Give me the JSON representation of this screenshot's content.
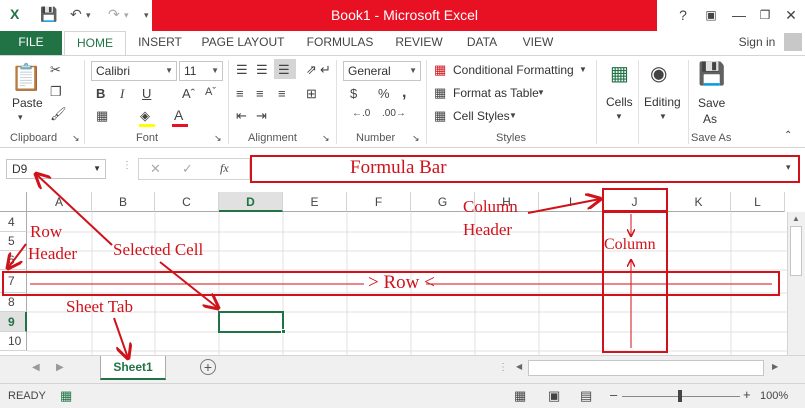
{
  "window": {
    "title": "Book1 - Microsoft Excel",
    "help_label": "?",
    "signin_label": "Sign in"
  },
  "tabs": [
    "FILE",
    "HOME",
    "INSERT",
    "PAGE LAYOUT",
    "FORMULAS",
    "REVIEW",
    "DATA",
    "VIEW"
  ],
  "ribbon": {
    "clipboard": {
      "paste_label": "Paste",
      "group_label": "Clipboard"
    },
    "font": {
      "font_name": "Calibri",
      "font_size": "11",
      "group_label": "Font"
    },
    "alignment": {
      "group_label": "Alignment"
    },
    "number": {
      "format": "General",
      "group_label": "Number",
      "currency": "$",
      "percent": "%",
      "comma": ","
    },
    "styles": {
      "items": [
        "Conditional Formatting",
        "Format as Table",
        "Cell Styles"
      ],
      "group_label": "Styles"
    },
    "cells": {
      "label": "Cells"
    },
    "editing": {
      "label": "Editing"
    },
    "save_as": {
      "label_line1": "Save",
      "label_line2": "As",
      "group_label": "Save As"
    }
  },
  "formula_bar": {
    "name_box": "D9",
    "fx_label": "fx",
    "content": ""
  },
  "grid": {
    "columns": [
      "A",
      "B",
      "C",
      "D",
      "E",
      "F",
      "G",
      "H",
      "I",
      "J",
      "K",
      "L"
    ],
    "rows": [
      "4",
      "5",
      "6",
      "7",
      "8",
      "9",
      "10"
    ],
    "selected_cell": "D9",
    "selected_column": "D",
    "selected_row": "9"
  },
  "sheets": {
    "tabs": [
      "Sheet1"
    ],
    "active": "Sheet1"
  },
  "status": {
    "mode": "READY",
    "zoom": "100%"
  },
  "annotations": {
    "formula_bar": "Formula Bar",
    "column_header_line1": "Column",
    "column_header_line2": "Header",
    "row_header_line1": "Row",
    "row_header_line2": "Header",
    "selected_cell": "Selected Cell",
    "column": "Column",
    "row": "> Row <",
    "sheet_tab": "Sheet Tab"
  },
  "colors": {
    "excel_green": "#217346",
    "title_red": "#e81123",
    "annotation_red": "#d0121b"
  }
}
